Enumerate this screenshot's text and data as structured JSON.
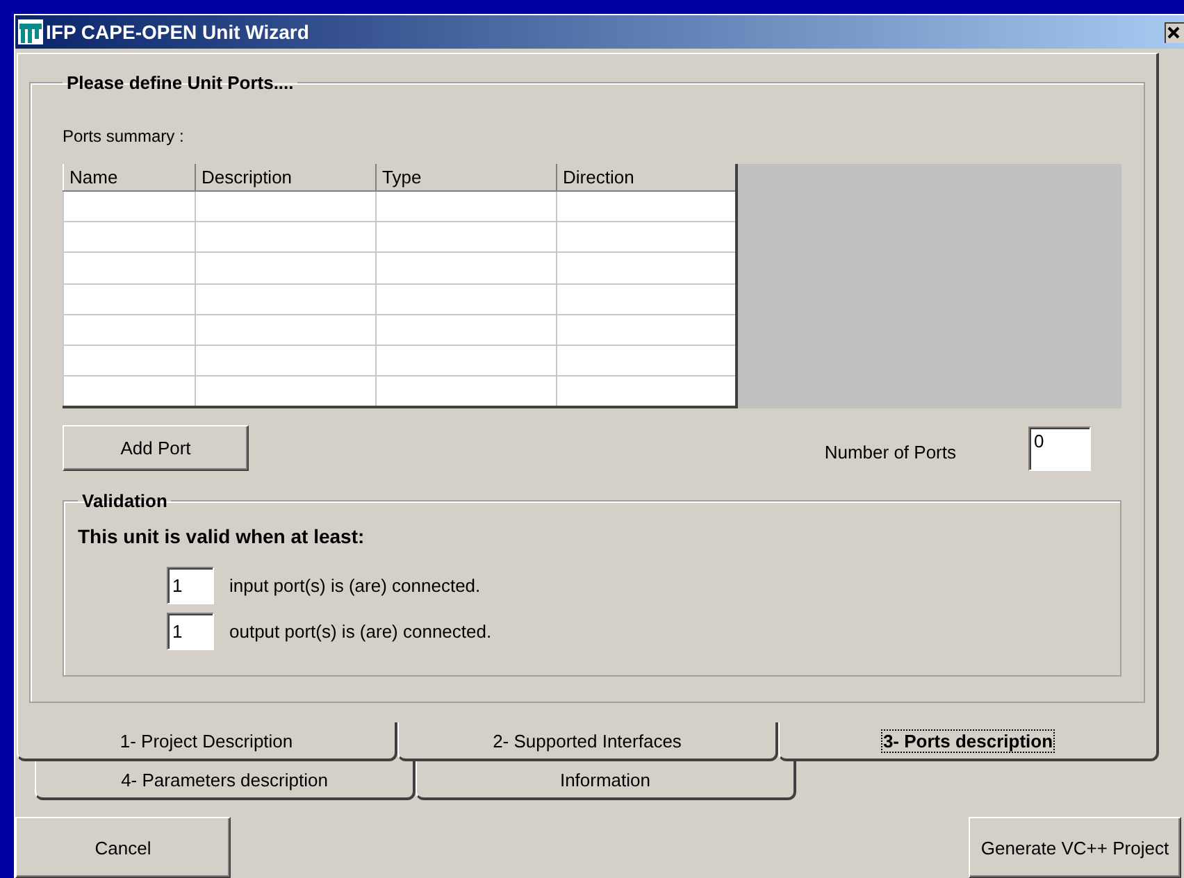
{
  "window": {
    "title": "IFP CAPE-OPEN Unit Wizard"
  },
  "group": {
    "title": "Please define Unit Ports....",
    "summary_label": "Ports summary :",
    "table": {
      "columns": [
        "Name",
        "Description",
        "Type",
        "Direction"
      ]
    },
    "add_button": "Add Port",
    "count": {
      "label": "Number of Ports",
      "value": "0"
    },
    "validation": {
      "title": "Validation",
      "heading": "This unit is valid when at least:",
      "rules": [
        {
          "value": "1",
          "text": "input port(s) is (are) connected."
        },
        {
          "value": "1",
          "text": "output port(s) is (are) connected."
        }
      ]
    }
  },
  "tab_rows": [
    {
      "tabs": [
        {
          "label": "1- Project Description",
          "selected": false
        },
        {
          "label": "2- Supported Interfaces",
          "selected": false
        },
        {
          "label": "3- Ports description",
          "selected": true
        }
      ]
    },
    {
      "tabs": [
        {
          "label": "4- Parameters description",
          "selected": false
        },
        {
          "label": "Information",
          "selected": false
        }
      ]
    }
  ],
  "buttons": {
    "cancel": "Cancel",
    "generate": "Generate VC++ Project"
  }
}
